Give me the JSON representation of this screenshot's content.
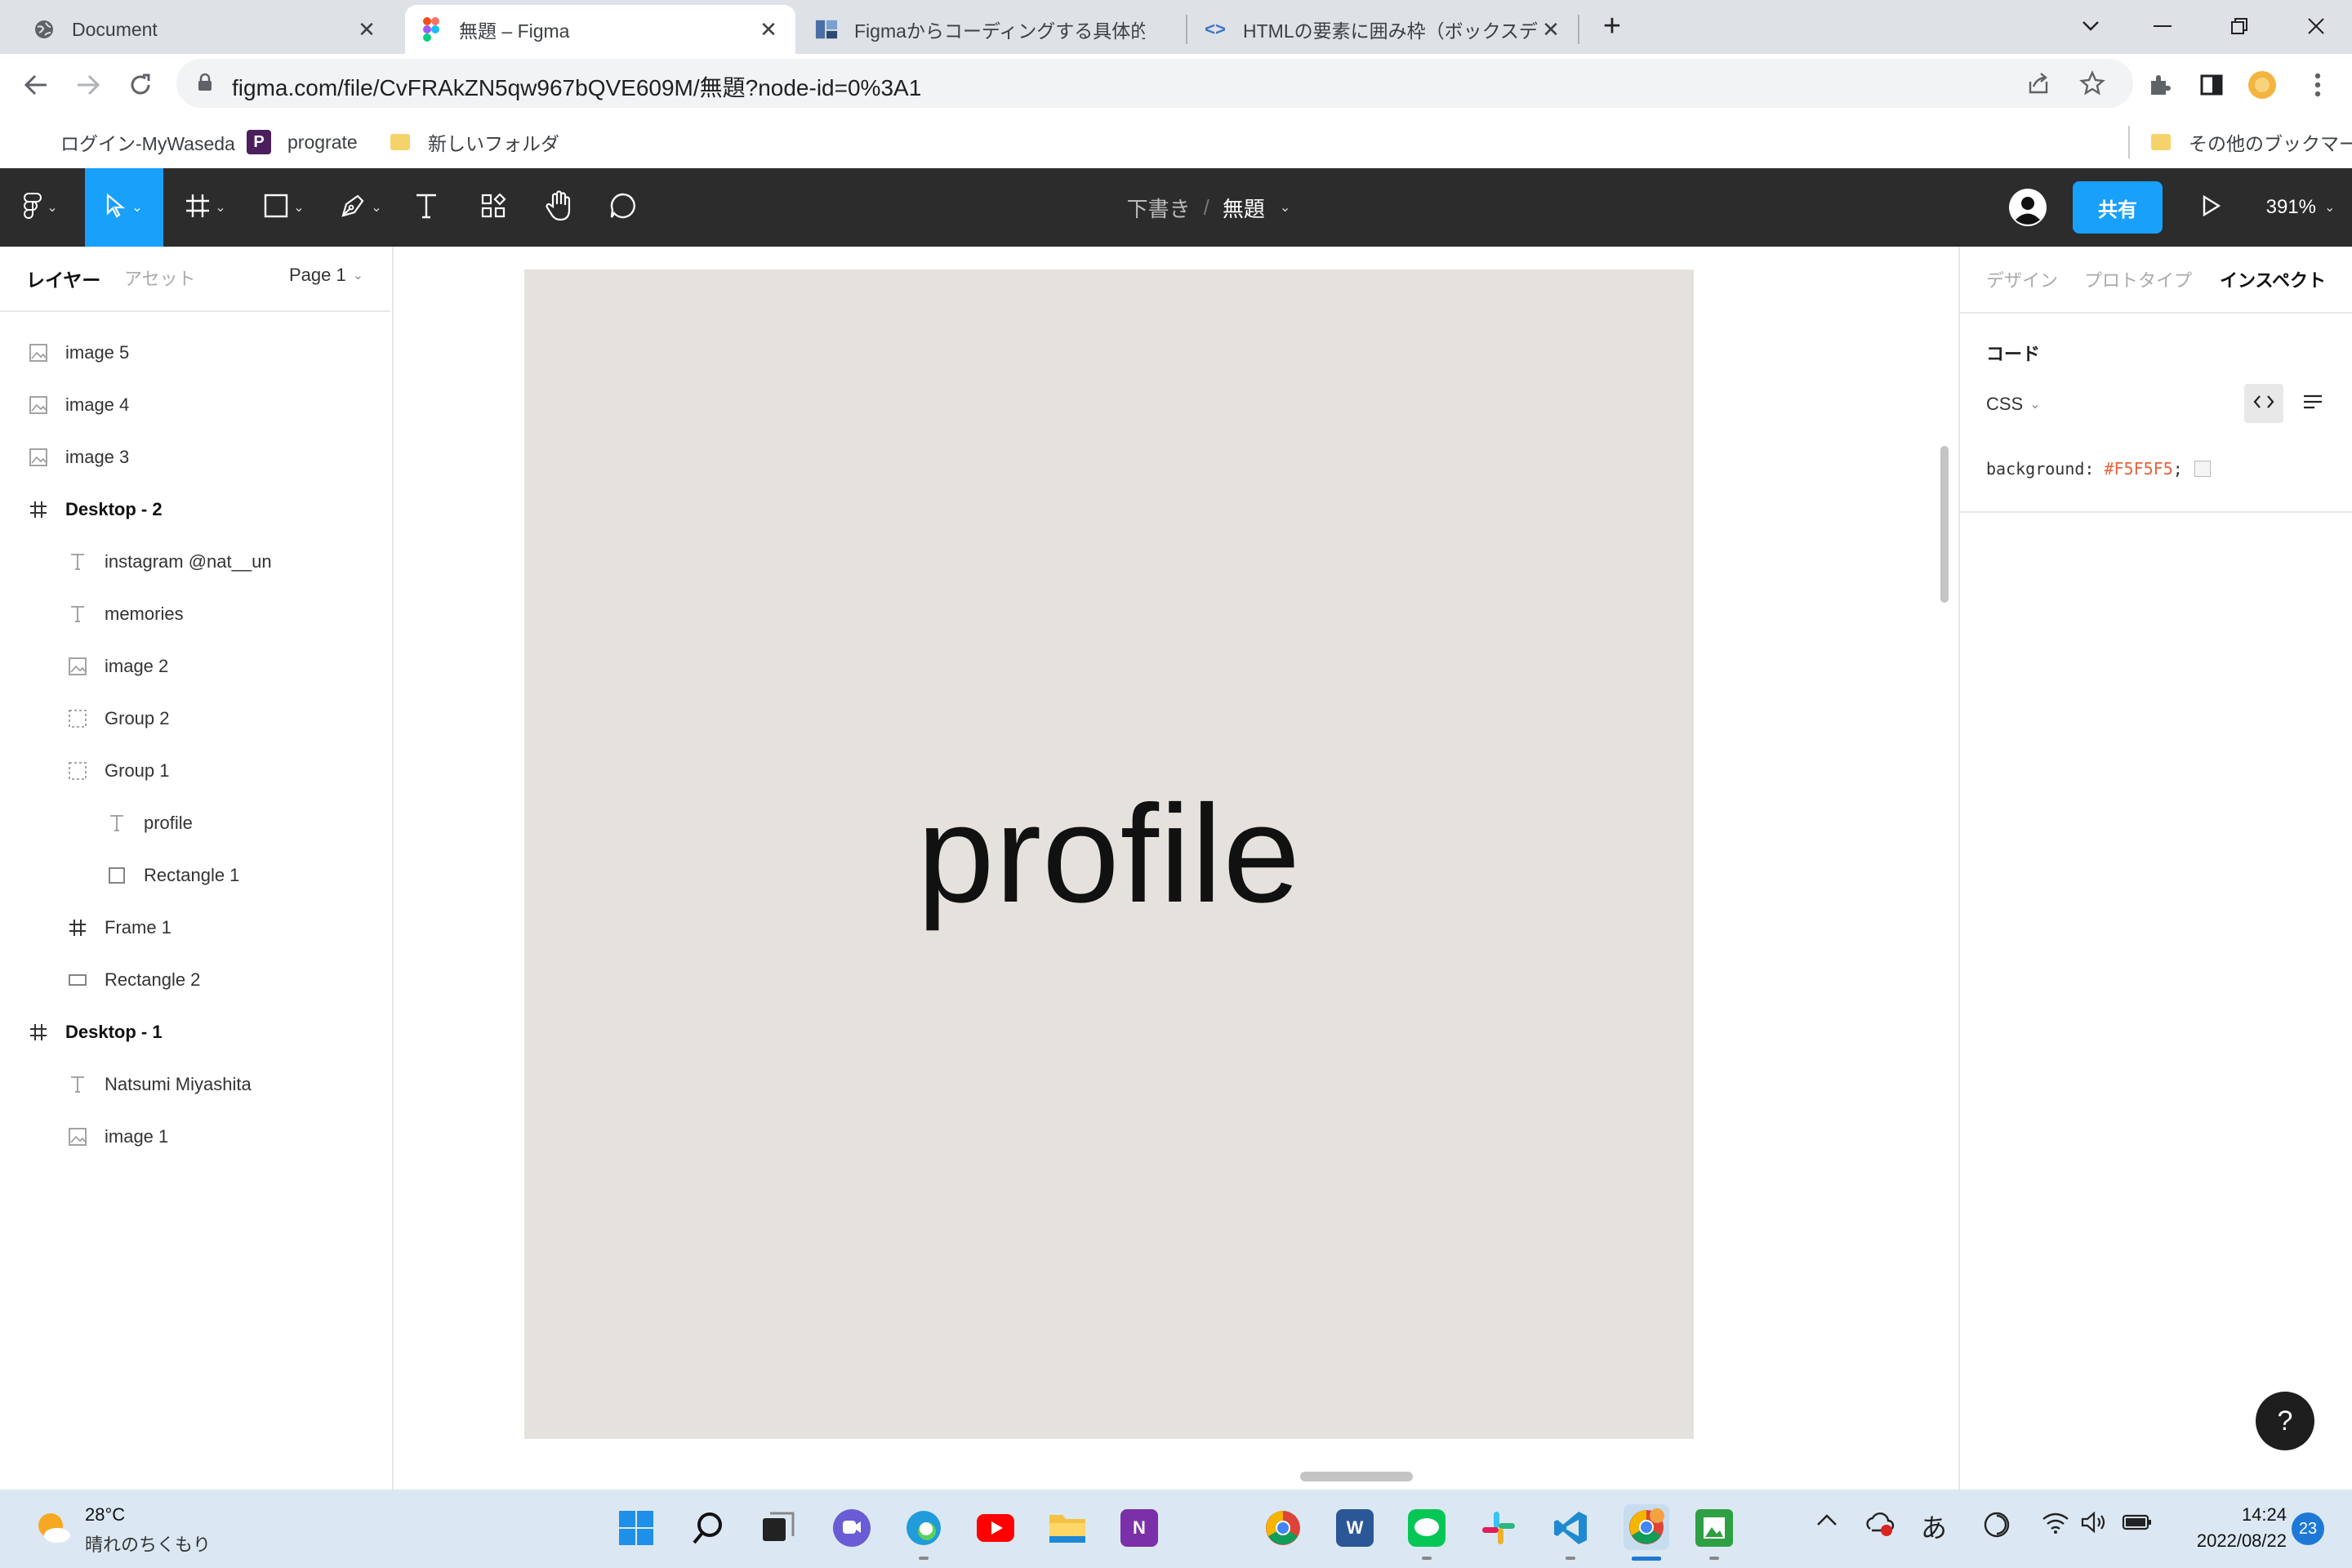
{
  "browser": {
    "tabs": [
      {
        "title": "Document",
        "icon": "globe-icon",
        "active": false
      },
      {
        "title": "無題 – Figma",
        "icon": "figma-icon",
        "active": true
      },
      {
        "title": "Figmaからコーディングする具体的な方",
        "icon": "site-icon",
        "active": false
      },
      {
        "title": "HTMLの要素に囲み枠（ボックスデザ",
        "icon": "code-icon",
        "active": false
      }
    ],
    "url": "figma.com/file/CvFRAkZN5qw967bQVE609M/無題?node-id=0%3A1",
    "bookmarks": [
      {
        "label": "ログイン-MyWaseda",
        "icon": "none"
      },
      {
        "label": "prograte",
        "icon": "prograte-icon"
      },
      {
        "label": "新しいフォルダ",
        "icon": "folder-icon"
      }
    ],
    "other_bookmarks": "その他のブックマーク"
  },
  "figma_toolbar": {
    "breadcrumb_folder": "下書き",
    "breadcrumb_sep": "/",
    "file_name": "無題",
    "share_label": "共有",
    "zoom": "391%",
    "accent": "#18a0fb"
  },
  "left_panel": {
    "tab_layers": "レイヤー",
    "tab_assets": "アセット",
    "page": "Page 1",
    "layers": [
      {
        "name": "image 5",
        "type": "image",
        "indent": 0,
        "bold": false
      },
      {
        "name": "image 4",
        "type": "image",
        "indent": 0,
        "bold": false
      },
      {
        "name": "image 3",
        "type": "image",
        "indent": 0,
        "bold": false
      },
      {
        "name": "Desktop - 2",
        "type": "frame",
        "indent": 0,
        "bold": true
      },
      {
        "name": "instagram @nat__un",
        "type": "text",
        "indent": 1,
        "bold": false
      },
      {
        "name": "memories",
        "type": "text",
        "indent": 1,
        "bold": false
      },
      {
        "name": "image 2",
        "type": "image",
        "indent": 1,
        "bold": false
      },
      {
        "name": "Group 2",
        "type": "group",
        "indent": 1,
        "bold": false
      },
      {
        "name": "Group 1",
        "type": "group",
        "indent": 1,
        "bold": false
      },
      {
        "name": "profile",
        "type": "text",
        "indent": 2,
        "bold": false
      },
      {
        "name": "Rectangle 1",
        "type": "rect",
        "indent": 2,
        "bold": false
      },
      {
        "name": "Frame 1",
        "type": "frame",
        "indent": 1,
        "bold": false
      },
      {
        "name": "Rectangle 2",
        "type": "rect2",
        "indent": 1,
        "bold": false
      },
      {
        "name": "Desktop - 1",
        "type": "frame",
        "indent": 0,
        "bold": true
      },
      {
        "name": "Natsumi Miyashita",
        "type": "text",
        "indent": 1,
        "bold": false
      },
      {
        "name": "image 1",
        "type": "image",
        "indent": 1,
        "bold": false
      }
    ]
  },
  "canvas": {
    "frame_text": "profile",
    "frame_color": "#e5e2de"
  },
  "right_panel": {
    "tabs": [
      "デザイン",
      "プロトタイプ",
      "インスペクト"
    ],
    "section_title": "コード",
    "language": "CSS",
    "code_property": "background:",
    "code_value": "#F5F5F5",
    "code_semicolon": ";",
    "help": "?"
  },
  "taskbar": {
    "weather_temp": "28°C",
    "weather_desc": "晴れのちくもり",
    "ime": "あ",
    "time": "14:24",
    "date": "2022/08/22",
    "notifications": "23"
  }
}
